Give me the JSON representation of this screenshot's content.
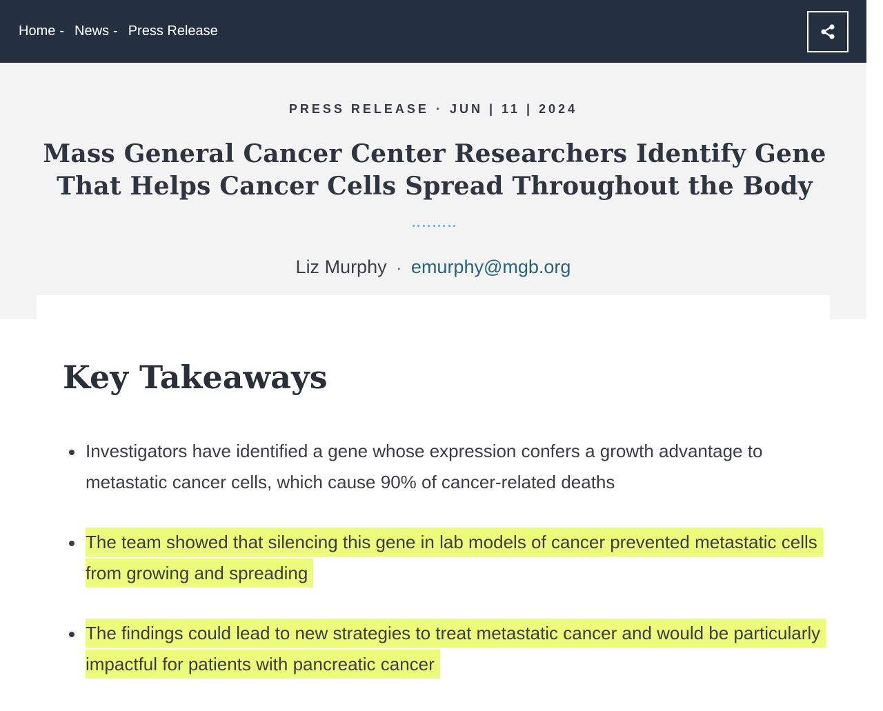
{
  "breadcrumb": {
    "items": [
      "Home",
      "News",
      "Press Release"
    ],
    "separator": "-"
  },
  "share": {
    "icon": "share-icon"
  },
  "hero": {
    "category": "PRESS RELEASE",
    "meta_separator": "·",
    "date": "JUN | 11 | 2024",
    "title": "Mass General Cancer Center Researchers Identify Gene That Helps Cancer Cells Spread Throughout the Body",
    "contact_name": "Liz Murphy",
    "contact_separator": "·",
    "contact_email": "emurphy@mgb.org"
  },
  "key_takeaways": {
    "heading": "Key Takeaways",
    "items": [
      {
        "text": "Investigators have identified a gene whose expression confers a growth advantage to metastatic cancer cells, which cause 90% of cancer-related deaths",
        "highlighted": false
      },
      {
        "text": "The team showed that silencing this gene in lab models of cancer prevented metastatic cells from growing and spreading",
        "highlighted": true
      },
      {
        "text": "The findings could lead to new strategies to treat metastatic cancer and would be particularly impactful for patients with pancreatic cancer",
        "highlighted": true
      }
    ]
  },
  "colors": {
    "topbar": "#24303f",
    "hero_bg": "#f3f3f4",
    "accent_dots": "#5bb2d6",
    "email_link": "#27637a",
    "highlight": "#edfb7a"
  }
}
